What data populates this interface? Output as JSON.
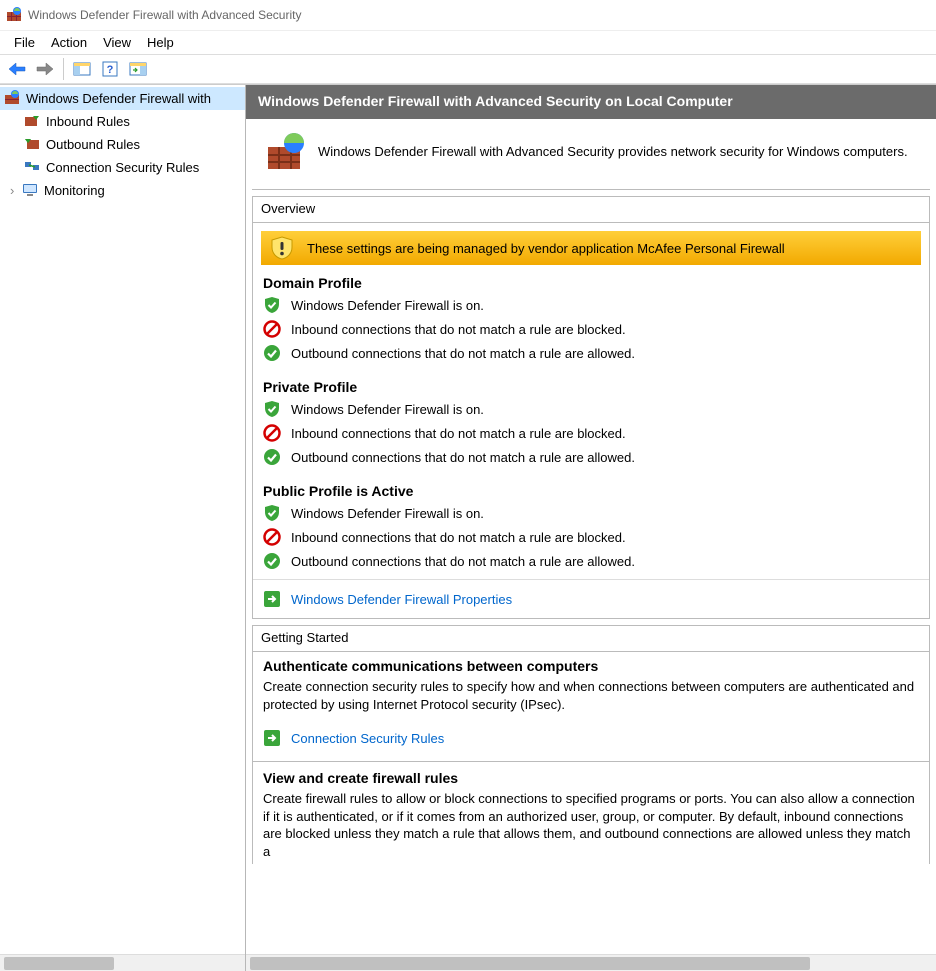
{
  "app": {
    "title": "Windows Defender Firewall with Advanced Security"
  },
  "menu": {
    "items": [
      "File",
      "Action",
      "View",
      "Help"
    ]
  },
  "tree": {
    "root": "Windows Defender Firewall with",
    "items": [
      "Inbound Rules",
      "Outbound Rules",
      "Connection Security Rules",
      "Monitoring"
    ]
  },
  "content": {
    "header": "Windows Defender Firewall with Advanced Security on Local Computer",
    "intro": "Windows Defender Firewall with Advanced Security provides network security for Windows computers.",
    "overview": {
      "title": "Overview",
      "banner": "These settings are being managed by vendor application McAfee  Personal Firewall",
      "profiles": [
        {
          "title": "Domain Profile",
          "lines": [
            {
              "icon": "shield-on",
              "text": "Windows Defender Firewall is on."
            },
            {
              "icon": "block",
              "text": "Inbound connections that do not match a rule are blocked."
            },
            {
              "icon": "allow",
              "text": "Outbound connections that do not match a rule are allowed."
            }
          ]
        },
        {
          "title": "Private Profile",
          "lines": [
            {
              "icon": "shield-on",
              "text": "Windows Defender Firewall is on."
            },
            {
              "icon": "block",
              "text": "Inbound connections that do not match a rule are blocked."
            },
            {
              "icon": "allow",
              "text": "Outbound connections that do not match a rule are allowed."
            }
          ]
        },
        {
          "title": "Public Profile is Active",
          "lines": [
            {
              "icon": "shield-on",
              "text": "Windows Defender Firewall is on."
            },
            {
              "icon": "block",
              "text": "Inbound connections that do not match a rule are blocked."
            },
            {
              "icon": "allow",
              "text": "Outbound connections that do not match a rule are allowed."
            }
          ]
        }
      ],
      "properties_link": "Windows Defender Firewall Properties"
    },
    "getting_started": {
      "title": "Getting Started",
      "sections": [
        {
          "heading": "Authenticate communications between computers",
          "body": "Create connection security rules to specify how and when connections between computers are authenticated and protected by using Internet Protocol security (IPsec).",
          "link": "Connection Security Rules"
        },
        {
          "heading": "View and create firewall rules",
          "body": "Create firewall rules to allow or block connections to specified programs or ports. You can also allow a connection if it is authenticated, or if it comes from an authorized user, group, or computer. By default, inbound connections are blocked unless they match a rule that allows them, and outbound connections are allowed unless they match a"
        }
      ]
    }
  }
}
